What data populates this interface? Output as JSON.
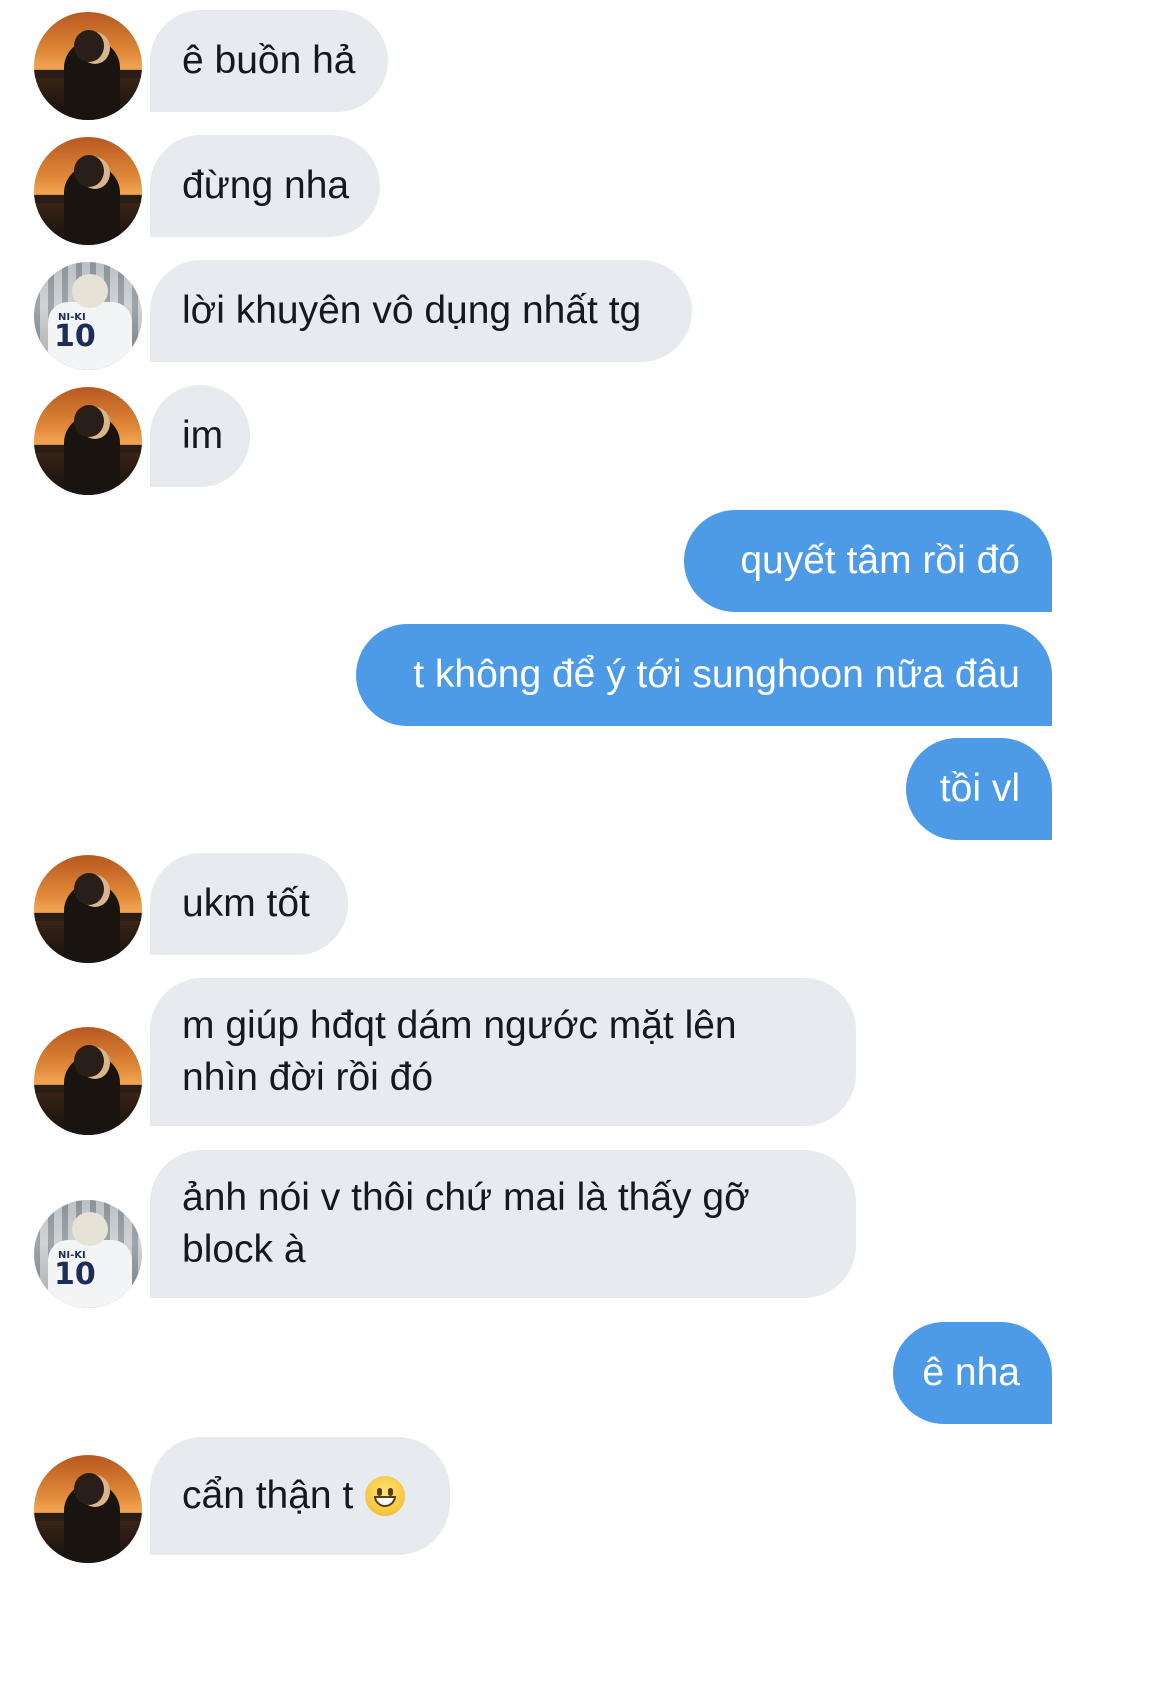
{
  "conversation": {
    "messages": [
      {
        "sender": "other",
        "avatar": "sunset-avatar",
        "text": "ê buồn hả"
      },
      {
        "sender": "other",
        "avatar": "sunset-avatar",
        "text": "đừng nha"
      },
      {
        "sender": "other",
        "avatar": "jersey-avatar",
        "text": "lời khuyên vô dụng nhất tg"
      },
      {
        "sender": "other",
        "avatar": "sunset-avatar",
        "text": "im"
      },
      {
        "sender": "me",
        "text": "quyết tâm rồi đó"
      },
      {
        "sender": "me",
        "text": "t không để ý tới sunghoon nữa đâu"
      },
      {
        "sender": "me",
        "text": "tồi vl"
      },
      {
        "sender": "other",
        "avatar": "sunset-avatar",
        "text": "ukm tốt"
      },
      {
        "sender": "other",
        "avatar": "sunset-avatar",
        "text": "m giúp hđqt dám ngước mặt lên nhìn đời rồi đó"
      },
      {
        "sender": "other",
        "avatar": "jersey-avatar",
        "text": "ảnh nói v thôi chứ mai là thấy gỡ block à"
      },
      {
        "sender": "me",
        "text": "ê nha"
      },
      {
        "sender": "other",
        "avatar": "sunset-avatar",
        "text": "cẩn thận t",
        "emoji": "grinning-face-emoji"
      }
    ]
  },
  "avatars": {
    "jersey_name": "NI-KI",
    "jersey_number": "10"
  },
  "colors": {
    "incoming_bubble": "#e7ebef",
    "outgoing_bubble": "#4d9be6",
    "incoming_text": "#15191d",
    "outgoing_text": "#ffffff"
  }
}
